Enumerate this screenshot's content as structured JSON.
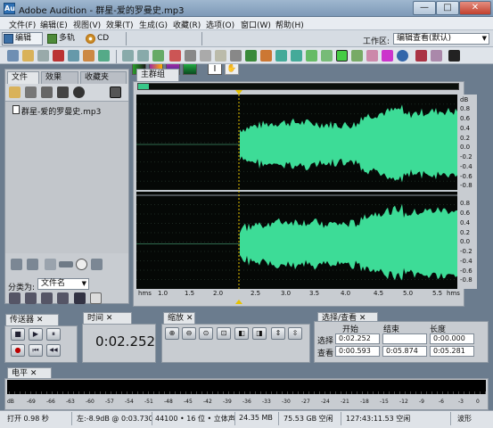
{
  "window": {
    "icon_text": "Au",
    "title": "Adobe Audition - 群星-爱的罗曼史.mp3",
    "minimize": "—",
    "maximize": "□",
    "close": "✕"
  },
  "menu": [
    "文件(F)",
    "编辑(E)",
    "视图(V)",
    "效果(T)",
    "生成(G)",
    "收藏(R)",
    "选项(O)",
    "窗口(W)",
    "帮助(H)"
  ],
  "modes": {
    "edit": "编辑",
    "multitrack": "多轨",
    "cd": "CD"
  },
  "workspace": {
    "label": "工作区:",
    "value": "编辑查看(默认)"
  },
  "left_panel": {
    "tabs": [
      "文件",
      "效果",
      "收藏夹"
    ],
    "file_item": "群星-爱的罗曼史.mp3",
    "sort_label": "分类为:",
    "sort_value": "文件名"
  },
  "main_panel": {
    "tab": "主群组",
    "db_labels": [
      "dB",
      "0.8",
      "0.6",
      "0.4",
      "0.2",
      "0.0",
      "-0.2",
      "-0.4",
      "-0.6",
      "-0.8",
      "0.8",
      "0.6",
      "0.4",
      "0.2",
      "0.0",
      "-0.2",
      "-0.4",
      "-0.6",
      "-0.8"
    ],
    "time_labels": [
      "hms",
      "1.0",
      "1.5",
      "2.0",
      "2.5",
      "3.0",
      "3.5",
      "4.0",
      "4.5",
      "5.0",
      "5.5",
      "hms"
    ],
    "waveform_color": "#3ddc97",
    "background": "#050806"
  },
  "transport": {
    "tab": "传送器",
    "buttons": [
      "■",
      "▶",
      "⏸",
      "●",
      "⏮",
      "◀◀",
      "▶▶",
      "⏭"
    ]
  },
  "time": {
    "tab": "时间",
    "value": "0:02.252"
  },
  "zoom": {
    "tab": "缩放"
  },
  "selection": {
    "tab": "选择/查看",
    "headers": [
      "开始",
      "结束",
      "长度"
    ],
    "rows": [
      {
        "label": "选择",
        "start": "0:02.252",
        "end": "",
        "length": "0:00.000"
      },
      {
        "label": "查看",
        "start": "0:00.593",
        "end": "0:05.874",
        "length": "0:05.281"
      }
    ]
  },
  "level": {
    "tab": "电平",
    "labels": [
      "dB",
      "-69",
      "-66",
      "-63",
      "-60",
      "-57",
      "-54",
      "-51",
      "-48",
      "-45",
      "-42",
      "-39",
      "-36",
      "-33",
      "-30",
      "-27",
      "-24",
      "-21",
      "-18",
      "-15",
      "-12",
      "-9",
      "-6",
      "-3",
      "0"
    ]
  },
  "status": {
    "open_time": "打开 0.98 秒",
    "level": "左:-8.9dB @ 0:03.730",
    "format": "44100 • 16 位 • 立体声",
    "size": "24.35 MB",
    "free": "75.53 GB 空闲",
    "free_time": "127:43:11.53 空闲",
    "view": "波形"
  }
}
